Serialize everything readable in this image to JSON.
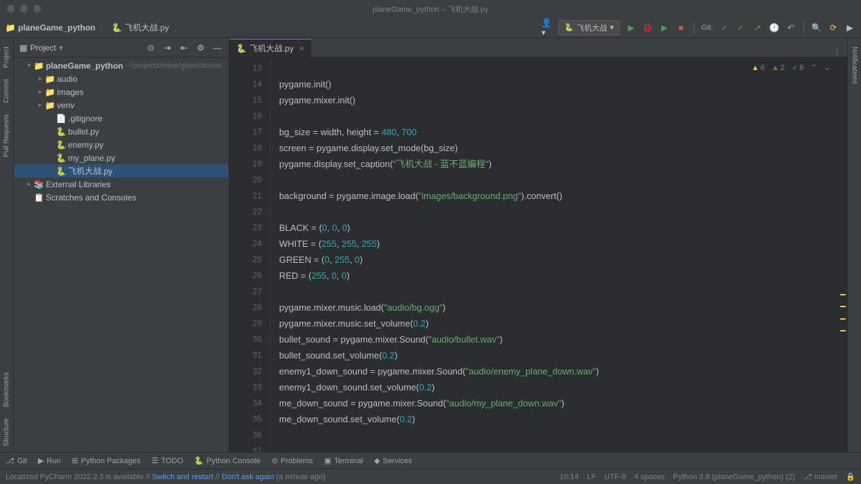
{
  "window": {
    "title": "planeGame_python – 飞机大战.py"
  },
  "breadcrumb": {
    "project": "planeGame_python",
    "file": "飞机大战.py"
  },
  "toolbar": {
    "run_config": "飞机大战",
    "git_label": "Git:"
  },
  "left_tools": [
    "Project",
    "Commit",
    "Pull Requests",
    "Bookmarks",
    "Structure"
  ],
  "right_tools": [
    "Notifications"
  ],
  "project_panel": {
    "title": "Project",
    "root": {
      "name": "planeGame_python",
      "path": "~/projects/mine/gitee/demos"
    },
    "items": [
      {
        "indent": 1,
        "arrow": "▾",
        "icon": "folder",
        "name": "planeGame_python",
        "path": "~/projects/mine/gitee/demos",
        "bold": true
      },
      {
        "indent": 2,
        "arrow": "▸",
        "icon": "folder",
        "name": "audio"
      },
      {
        "indent": 2,
        "arrow": "▸",
        "icon": "folder",
        "name": "images"
      },
      {
        "indent": 2,
        "arrow": "▸",
        "icon": "folder",
        "name": "venv"
      },
      {
        "indent": 3,
        "arrow": "",
        "icon": "file",
        "name": ".gitignore"
      },
      {
        "indent": 3,
        "arrow": "",
        "icon": "python",
        "name": "bullet.py"
      },
      {
        "indent": 3,
        "arrow": "",
        "icon": "python",
        "name": "enemy.py"
      },
      {
        "indent": 3,
        "arrow": "",
        "icon": "python",
        "name": "my_plane.py"
      },
      {
        "indent": 3,
        "arrow": "",
        "icon": "python",
        "name": "飞机大战.py",
        "selected": true
      },
      {
        "indent": 1,
        "arrow": "▸",
        "icon": "lib",
        "name": "External Libraries"
      },
      {
        "indent": 1,
        "arrow": "",
        "icon": "scratch",
        "name": "Scratches and Consoles"
      }
    ]
  },
  "editor": {
    "tab": "飞机大战.py",
    "first_line": 13,
    "inspection": {
      "warn1": "6",
      "warn2": "2",
      "ok": "6"
    },
    "lines": [
      {
        "n": 13,
        "tokens": []
      },
      {
        "n": 14,
        "tokens": [
          {
            "t": "pygame.init()",
            "c": "id"
          }
        ]
      },
      {
        "n": 15,
        "tokens": [
          {
            "t": "pygame.mixer.init()",
            "c": "id"
          }
        ]
      },
      {
        "n": 16,
        "tokens": []
      },
      {
        "n": 17,
        "tokens": [
          {
            "t": "bg_size = width, height = ",
            "c": "id"
          },
          {
            "t": "480",
            "c": "num"
          },
          {
            "t": ", ",
            "c": "id"
          },
          {
            "t": "700",
            "c": "num"
          }
        ]
      },
      {
        "n": 18,
        "tokens": [
          {
            "t": "screen = pygame.display.set_mode(bg_size)",
            "c": "id"
          }
        ]
      },
      {
        "n": 19,
        "tokens": [
          {
            "t": "pygame.display.set_caption(",
            "c": "id"
          },
          {
            "t": "\"飞机大战 - 蓝不蓝编程\"",
            "c": "str"
          },
          {
            "t": ")",
            "c": "id"
          }
        ]
      },
      {
        "n": 20,
        "tokens": []
      },
      {
        "n": 21,
        "tokens": [
          {
            "t": "background = pygame.image.load(",
            "c": "id"
          },
          {
            "t": "\"images/background.png\"",
            "c": "str"
          },
          {
            "t": ").convert()",
            "c": "id"
          }
        ]
      },
      {
        "n": 22,
        "tokens": []
      },
      {
        "n": 23,
        "tokens": [
          {
            "t": "BLACK = (",
            "c": "id"
          },
          {
            "t": "0",
            "c": "num"
          },
          {
            "t": ", ",
            "c": "id"
          },
          {
            "t": "0",
            "c": "num"
          },
          {
            "t": ", ",
            "c": "id"
          },
          {
            "t": "0",
            "c": "num"
          },
          {
            "t": ")",
            "c": "id"
          }
        ]
      },
      {
        "n": 24,
        "tokens": [
          {
            "t": "WHITE = (",
            "c": "id"
          },
          {
            "t": "255",
            "c": "num"
          },
          {
            "t": ", ",
            "c": "id"
          },
          {
            "t": "255",
            "c": "num"
          },
          {
            "t": ", ",
            "c": "id"
          },
          {
            "t": "255",
            "c": "num"
          },
          {
            "t": ")",
            "c": "id"
          }
        ]
      },
      {
        "n": 25,
        "tokens": [
          {
            "t": "GREEN = (",
            "c": "id"
          },
          {
            "t": "0",
            "c": "num"
          },
          {
            "t": ", ",
            "c": "id"
          },
          {
            "t": "255",
            "c": "num"
          },
          {
            "t": ", ",
            "c": "id"
          },
          {
            "t": "0",
            "c": "num"
          },
          {
            "t": ")",
            "c": "id"
          }
        ]
      },
      {
        "n": 26,
        "tokens": [
          {
            "t": "RED = (",
            "c": "id"
          },
          {
            "t": "255",
            "c": "num"
          },
          {
            "t": ", ",
            "c": "id"
          },
          {
            "t": "0",
            "c": "num"
          },
          {
            "t": ", ",
            "c": "id"
          },
          {
            "t": "0",
            "c": "num"
          },
          {
            "t": ")",
            "c": "id"
          }
        ]
      },
      {
        "n": 27,
        "tokens": []
      },
      {
        "n": 28,
        "tokens": [
          {
            "t": "pygame.mixer.music.load(",
            "c": "id"
          },
          {
            "t": "\"audio/bg.ogg\"",
            "c": "str"
          },
          {
            "t": ")",
            "c": "id"
          }
        ]
      },
      {
        "n": 29,
        "tokens": [
          {
            "t": "pygame.mixer.music.set_volume(",
            "c": "id"
          },
          {
            "t": "0.2",
            "c": "num"
          },
          {
            "t": ")",
            "c": "id"
          }
        ]
      },
      {
        "n": 30,
        "tokens": [
          {
            "t": "bullet_sound = pygame.mixer.Sound(",
            "c": "id"
          },
          {
            "t": "\"audio/bullet.wav\"",
            "c": "str"
          },
          {
            "t": ")",
            "c": "id"
          }
        ]
      },
      {
        "n": 31,
        "tokens": [
          {
            "t": "bullet_sound.set_volume(",
            "c": "id"
          },
          {
            "t": "0.2",
            "c": "num"
          },
          {
            "t": ")",
            "c": "id"
          }
        ]
      },
      {
        "n": 32,
        "tokens": [
          {
            "t": "enemy1_down_sound = pygame.mixer.Sound(",
            "c": "id"
          },
          {
            "t": "\"audio/enemy_plane_down.wav\"",
            "c": "str"
          },
          {
            "t": ")",
            "c": "id"
          }
        ]
      },
      {
        "n": 33,
        "tokens": [
          {
            "t": "enemy1_down_sound.set_volume(",
            "c": "id"
          },
          {
            "t": "0.2",
            "c": "num"
          },
          {
            "t": ")",
            "c": "id"
          }
        ]
      },
      {
        "n": 34,
        "tokens": [
          {
            "t": "me_down_sound = pygame.mixer.Sound(",
            "c": "id"
          },
          {
            "t": "\"audio/my_plane_down.wav\"",
            "c": "str"
          },
          {
            "t": ")",
            "c": "id"
          }
        ]
      },
      {
        "n": 35,
        "tokens": [
          {
            "t": "me_down_sound.set_volume(",
            "c": "id"
          },
          {
            "t": "0.2",
            "c": "num"
          },
          {
            "t": ")",
            "c": "id"
          }
        ]
      },
      {
        "n": 36,
        "tokens": []
      },
      {
        "n": 37,
        "tokens": []
      }
    ]
  },
  "bottom_tools": [
    "Git",
    "Run",
    "Python Packages",
    "TODO",
    "Python Console",
    "Problems",
    "Terminal",
    "Services"
  ],
  "status": {
    "message_pre": "Localized PyCharm 2022.2.3 is available // ",
    "link1": "Switch and restart",
    "sep": " // ",
    "link2": "Don't ask again",
    "post": " (a minute ago)",
    "curpos": "10:14",
    "lineend": "LF",
    "encoding": "UTF-8",
    "indent": "4 spaces",
    "interpreter": "Python 3.8 (planeGame_python) (2)",
    "branch": "master"
  }
}
